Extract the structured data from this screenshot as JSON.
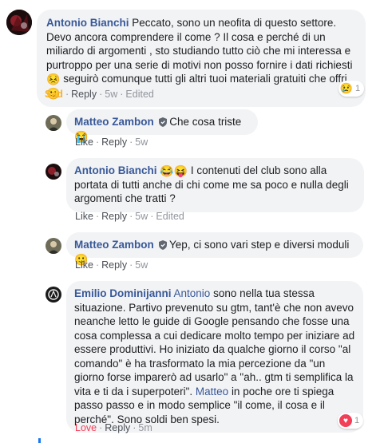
{
  "comments": [
    {
      "author": "Antonio Bianchi",
      "text_parts": [
        "Peccato, sono un neofita di questo settore. Devo ancora comprendere il come ? Il cosa e perché di un miliardo di argomenti , sto studiando tutto ciò che mi interessa e purtroppo per una serie di motivi non posso fornire i dati richiesti",
        "seguirò comunque tutti gli altri tuoi materiali gratuiti che offri"
      ],
      "emojis": [
        "😣",
        "🙂"
      ],
      "reaction_label": "Sad",
      "reply_label": "Reply",
      "time": "5w",
      "edited": "Edited",
      "badge_icon": "😢",
      "badge_count": "1"
    },
    {
      "author": "Matteo Zambon",
      "text": "Che cosa triste",
      "emoji": "😭",
      "like_label": "Like",
      "reply_label": "Reply",
      "time": "5w"
    },
    {
      "author": "Antonio Bianchi",
      "emojis": [
        "😂",
        "😝"
      ],
      "text": "I contenuti del club sono alla portata di tutti anche di chi come me sa poco e nulla degli argomenti che tratti ?",
      "like_label": "Like",
      "reply_label": "Reply",
      "time": "5w",
      "edited": "Edited"
    },
    {
      "author": "Matteo Zambon",
      "text": "Yep, ci sono vari step e diversi moduli",
      "emoji": "🙂",
      "like_label": "Like",
      "reply_label": "Reply",
      "time": "5w"
    },
    {
      "author": "Emilio Dominijanni",
      "mention1": "Antonio",
      "text1": "sono nella tua stessa situazione. Partivo prevenuto su gtm, tant'è che non avevo neanche letto le guide di Google pensando che fosse una cosa complessa a cui dedicare molto tempo per iniziare ad essere produttivi. Ho iniziato da qualche giorno il corso \"al comando\" è ha trasformato la mia percezione da \"un giorno forse imparerò ad usarlo\" a \"ah.. gtm ti semplifica la vita e ti da i superpoteri\".",
      "mention2": "Matteo",
      "text2": "in poche ore ti spiega passo passo e in modo semplice \"il come, il cosa e il perché\". Sono soldi ben spesi.",
      "reaction_label": "Love",
      "reply_label": "Reply",
      "time": "5m",
      "badge_icon": "♥",
      "badge_count": "1"
    }
  ],
  "colors": {
    "name": "#385898",
    "bubble": "#f2f3f5",
    "sad": "#f7b125",
    "love": "#f33e58",
    "meta": "#90949c"
  }
}
